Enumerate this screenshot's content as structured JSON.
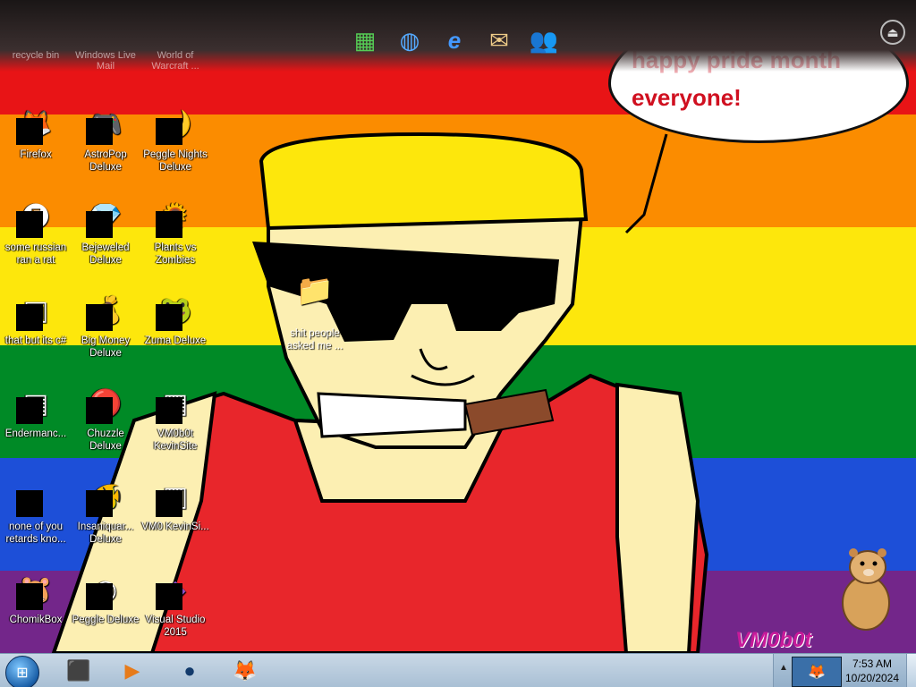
{
  "wallpaper": {
    "stripe_colors": [
      "#e81416",
      "#fb8c00",
      "#fde70c",
      "#008a26",
      "#1d4fd8",
      "#73268a"
    ],
    "speech_bubble": {
      "line1": "happy pride month",
      "line2": "everyone!"
    },
    "watermark": "VM0b0t"
  },
  "top_dock": {
    "items": [
      {
        "icon": "spreadsheet-icon"
      },
      {
        "icon": "globe-search-icon"
      },
      {
        "icon": "internet-explorer-icon"
      },
      {
        "icon": "mail-icon"
      },
      {
        "icon": "messenger-icon"
      }
    ],
    "faded_labels": [
      "recycle bin",
      "Windows Live Mail",
      "World of Warcraft ..."
    ]
  },
  "desktop_icons": [
    {
      "label": "Firefox",
      "glyph": "🦊"
    },
    {
      "label": "AstroPop Deluxe",
      "glyph": "🎮"
    },
    {
      "label": "Peggle Nights Deluxe",
      "glyph": "🌙"
    },
    {
      "label": "some russian ran a rat",
      "glyph": "🅔"
    },
    {
      "label": "Bejeweled Deluxe",
      "glyph": "💎"
    },
    {
      "label": "Plants vs Zombies",
      "glyph": "🌻"
    },
    {
      "label": "that but its c#",
      "glyph": "▣"
    },
    {
      "label": "Big Money Deluxe",
      "glyph": "💰"
    },
    {
      "label": "Zuma Deluxe",
      "glyph": "🐸"
    },
    {
      "label": "Endermanc...",
      "glyph": "▤"
    },
    {
      "label": "Chuzzle Deluxe",
      "glyph": "🔴"
    },
    {
      "label": "VM0b0t KevinSite",
      "glyph": "▦"
    },
    {
      "label": "none of you retards kno...",
      "glyph": "◐"
    },
    {
      "label": "Insaniquar... Deluxe",
      "glyph": "🐠"
    },
    {
      "label": "VM0 KevinSi...",
      "glyph": "▥"
    },
    {
      "label": "ChomikBox",
      "glyph": "🐹"
    },
    {
      "label": "Peggle Deluxe",
      "glyph": "◉"
    },
    {
      "label": "Visual Studio 2015",
      "glyph": "◆"
    }
  ],
  "center_folder": {
    "label": "shit people asked me ...",
    "glyph": "📁"
  },
  "taskbar": {
    "start_icon": "windows-orb-icon",
    "pinned": [
      {
        "name": "taskbar-app-1",
        "icon": "black-box-icon",
        "glyph": "⬛"
      },
      {
        "name": "taskbar-media-player",
        "icon": "media-player-icon",
        "glyph": "▶"
      },
      {
        "name": "taskbar-app-3",
        "icon": "dark-globe-icon",
        "glyph": "●"
      },
      {
        "name": "taskbar-firefox",
        "icon": "firefox-icon",
        "glyph": "🦊"
      }
    ],
    "tray": {
      "time": "7:53 AM",
      "date": "10/20/2024"
    }
  }
}
